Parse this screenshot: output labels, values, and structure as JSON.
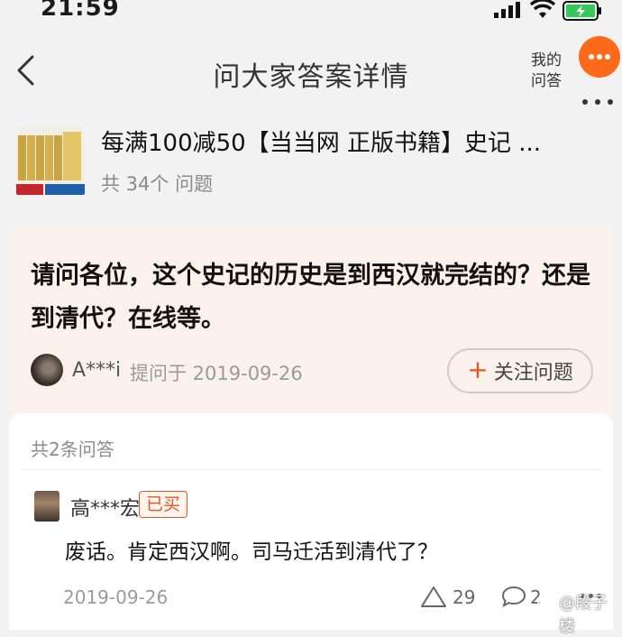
{
  "status_bar": {
    "time": "21:59"
  },
  "nav": {
    "title": "问大家答案详情",
    "my_answers_line1": "我的",
    "my_answers_line2": "问答"
  },
  "product": {
    "title": "每满100减50【当当网 正版书籍】史记 ...",
    "question_count": "共 34个 问题"
  },
  "question": {
    "text": "请问各位，这个史记的历史是到西汉就完结的？还是到清代？在线等。",
    "asker": "A***i",
    "asked_at": "提问于 2019-09-26",
    "follow_label": "关注问题"
  },
  "answers": {
    "count_label": "共2条问答",
    "items": [
      {
        "user": "高***宏",
        "badge": "已买",
        "text": "废话。肯定西汉啊。司马迁活到清代了？",
        "date": "2019-09-26",
        "likes": "29",
        "comments": "2"
      }
    ]
  },
  "watermark": {
    "text": "@段子楼"
  },
  "colors": {
    "accent": "#ff6a1a",
    "question_bg": "#fbf1ec",
    "badge": "#e8561d"
  },
  "icons": [
    "back-icon",
    "signal-icon",
    "wifi-icon",
    "battery-icon",
    "more-icon",
    "plus-icon",
    "like-icon",
    "comment-icon",
    "more-icon"
  ]
}
